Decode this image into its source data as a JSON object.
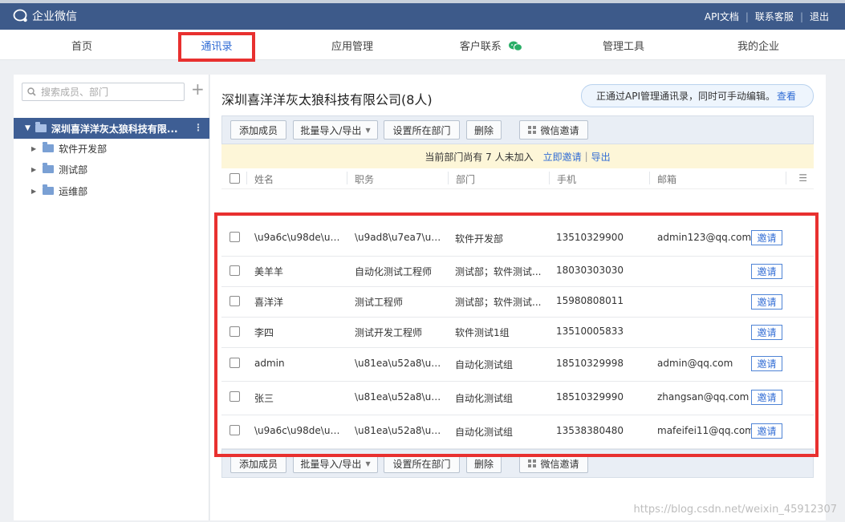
{
  "app": {
    "title": "企业微信"
  },
  "topbar": {
    "links": [
      "API文档",
      "联系客服",
      "退出"
    ],
    "separator": "|"
  },
  "nav": {
    "items": [
      "首页",
      "通讯录",
      "应用管理",
      "客户联系",
      "管理工具",
      "我的企业"
    ],
    "active": "通讯录"
  },
  "sidebar": {
    "search_placeholder": "搜索成员、部门",
    "add_symbol": "+",
    "root": "深圳喜洋洋灰太狼科技有限...",
    "departments": [
      "软件开发部",
      "测试部",
      "运维部"
    ]
  },
  "main": {
    "company_title": "深圳喜洋洋灰太狼科技有限公司(8人)",
    "api_note": "正通过API管理通讯录，同时可手动编辑。",
    "api_view": "查看",
    "toolbar": {
      "add_member": "添加成员",
      "batch": "批量导入/导出",
      "set_dept": "设置所在部门",
      "delete": "删除",
      "wechat_invite": "微信邀请"
    },
    "notice": {
      "text": "当前部门尚有 7 人未加入",
      "invite_now": "立即邀请",
      "sep": "|",
      "export": "导出"
    },
    "columns": [
      "姓名",
      "职务",
      "部门",
      "手机",
      "邮箱"
    ],
    "invite_label": "邀请",
    "rows": [
      {
        "name": "\\u9a6c\\u98de\\u98...",
        "title": "\\u9ad8\\u7ea7\\u6d...",
        "dept": "软件开发部",
        "phone": "13510329900",
        "email": "admin123@qq.com"
      },
      {
        "name": "美羊羊",
        "title": "自动化测试工程师",
        "dept": "测试部；软件测试...",
        "phone": "18030303030",
        "email": ""
      },
      {
        "name": "喜洋洋",
        "title": "测试工程师",
        "dept": "测试部；软件测试...",
        "phone": "15980808011",
        "email": ""
      },
      {
        "name": "李四",
        "title": "测试开发工程师",
        "dept": "软件测试1组",
        "phone": "13510005833",
        "email": ""
      },
      {
        "name": "admin",
        "title": "\\u81ea\\u52a8\\u53...",
        "dept": "自动化测试组",
        "phone": "18510329998",
        "email": "admin@qq.com"
      },
      {
        "name": "张三",
        "title": "\\u81ea\\u52a8\\u53...",
        "dept": "自动化测试组",
        "phone": "18510329990",
        "email": "zhangsan@qq.com"
      },
      {
        "name": "\\u9a6c\\u98de\\u98...",
        "title": "\\u81ea\\u52a8\\u53...",
        "dept": "自动化测试组",
        "phone": "13538380480",
        "email": "mafeifei11@qq.com"
      }
    ]
  },
  "watermark": "https://blog.csdn.net/weixin_45912307",
  "colors": {
    "topbar": "#3d5a8a",
    "accent": "#2f6bd4",
    "highlight": "#e8302f",
    "notice_bg": "#fdf6d8"
  }
}
